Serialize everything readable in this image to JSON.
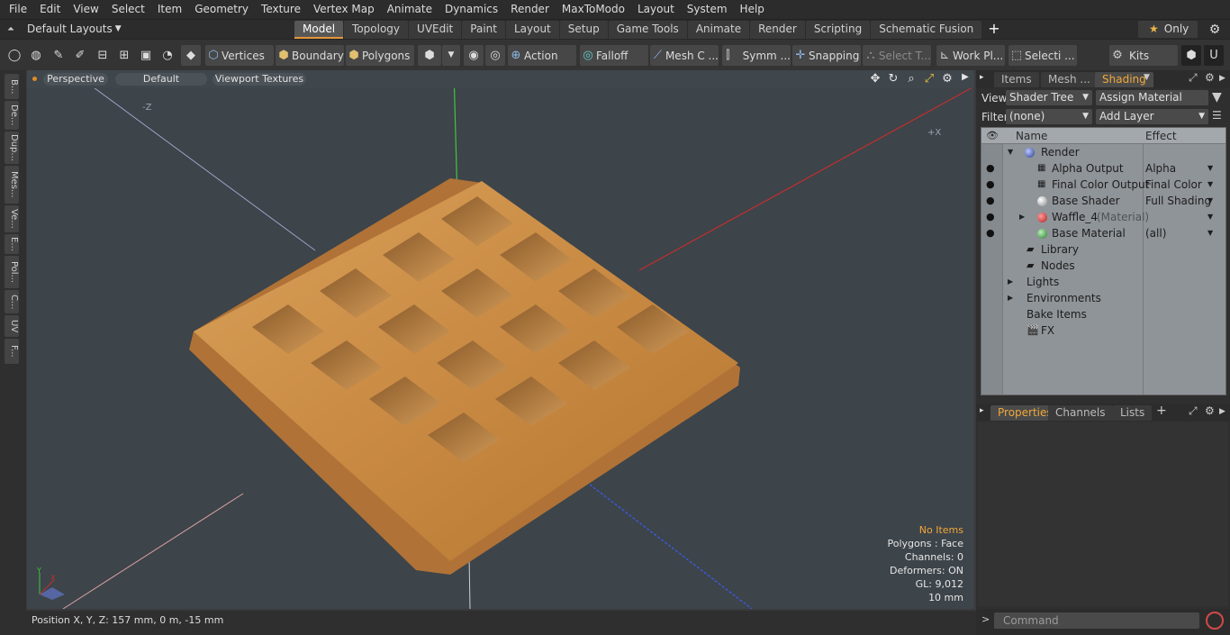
{
  "menu": [
    "File",
    "Edit",
    "View",
    "Select",
    "Item",
    "Geometry",
    "Texture",
    "Vertex Map",
    "Animate",
    "Dynamics",
    "Render",
    "MaxToModo",
    "Layout",
    "System",
    "Help"
  ],
  "layout_select": "Default Layouts",
  "tabs": [
    {
      "label": "Model",
      "active": true
    },
    {
      "label": "Topology"
    },
    {
      "label": "UVEdit"
    },
    {
      "label": "Paint"
    },
    {
      "label": "Layout"
    },
    {
      "label": "Setup"
    },
    {
      "label": "Game Tools"
    },
    {
      "label": "Animate"
    },
    {
      "label": "Render"
    },
    {
      "label": "Scripting"
    },
    {
      "label": "Schematic Fusion"
    }
  ],
  "only_label": "Only",
  "toolbar": {
    "vertices": "Vertices",
    "boundary": "Boundary",
    "polygons": "Polygons",
    "action": "Action",
    "falloff": "Falloff",
    "mesh": "Mesh C ...",
    "symm": "Symm ...",
    "snapping": "Snapping",
    "select_t": "Select T...",
    "work_pl": "Work Pl...",
    "selecti": "Selecti ...",
    "kits": "Kits"
  },
  "left_tabs": [
    "B...",
    "De...",
    "Dup...",
    "Mes...",
    "Ve...",
    "E...",
    "Pol...",
    "C...",
    "UV",
    "F..."
  ],
  "viewport": {
    "perspective": "Perspective",
    "default": "Default",
    "viewport_textures": "Viewport Textures",
    "info": {
      "no_items": "No Items",
      "polygons": "Polygons : Face",
      "channels": "Channels: 0",
      "deformers": "Deformers: ON",
      "gl": "GL: 9,012",
      "scale": "10 mm"
    },
    "axis_neg_z": "-Z",
    "axis_pos_x": "+X"
  },
  "status": "Position X, Y, Z:   157 mm, 0 m, -15 mm",
  "right_panel": {
    "tabs": [
      "Items",
      "Mesh ...",
      "Shading"
    ],
    "view_label": "View",
    "view_value": "Shader Tree",
    "assign_material": "Assign Material",
    "filter_label": "Filter",
    "filter_value": "(none)",
    "add_layer": "Add Layer",
    "col_name": "Name",
    "col_effect": "Effect",
    "tree": [
      {
        "name": "Render",
        "effect": "",
        "indent": 0,
        "expander": "▼",
        "icon": "render-sphere-icon"
      },
      {
        "name": "Alpha Output",
        "effect": "Alpha",
        "indent": 1,
        "icon": "output-icon",
        "eye": true
      },
      {
        "name": "Final Color Output",
        "effect": "Final Color",
        "indent": 1,
        "icon": "output-icon",
        "eye": true
      },
      {
        "name": "Base Shader",
        "effect": "Full Shading",
        "indent": 1,
        "icon": "shader-sphere-icon",
        "eye": true
      },
      {
        "name": "Waffle_4",
        "suffix": "(Material)",
        "effect": "",
        "indent": 1,
        "expander": "▶",
        "icon": "material-sphere-icon",
        "eye": true
      },
      {
        "name": "Base Material",
        "effect": "(all)",
        "indent": 1,
        "icon": "base-material-icon",
        "eye": true
      },
      {
        "name": "Library",
        "indent": 0,
        "icon": "folder-icon"
      },
      {
        "name": "Nodes",
        "indent": 0,
        "icon": "folder-icon"
      },
      {
        "name": "Lights",
        "indent": 0,
        "expander": "▶"
      },
      {
        "name": "Environments",
        "indent": 0,
        "expander": "▶"
      },
      {
        "name": "Bake Items",
        "indent": 0
      },
      {
        "name": "FX",
        "indent": 0,
        "icon": "clapper-icon"
      }
    ],
    "props_tabs": [
      "Properties",
      "Channels",
      "Lists"
    ],
    "command_placeholder": "Command"
  },
  "colors": {
    "accent": "#e6953a",
    "x_axis": "#c0302e",
    "y_axis": "#3ec83a",
    "z_axis": "#3a5ad8"
  }
}
